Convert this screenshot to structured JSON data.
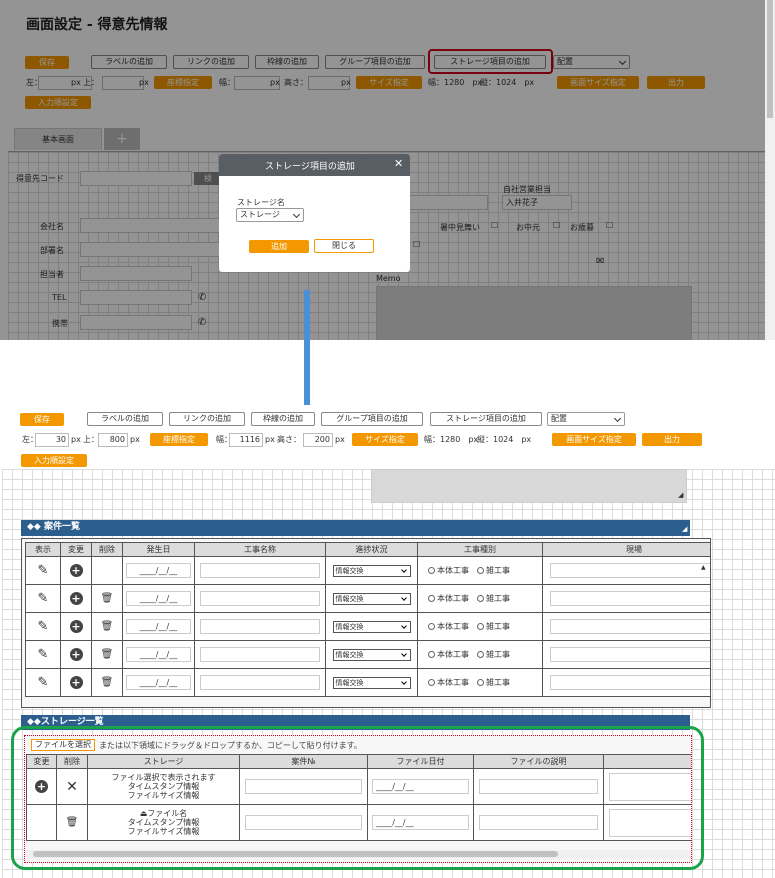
{
  "top": {
    "title": "画面設定 - 得意先情報",
    "toolbar": {
      "save": "保存",
      "add_label": "ラベルの追加",
      "add_link": "リンクの追加",
      "add_frame": "枠線の追加",
      "add_group": "グループ項目の追加",
      "add_storage": "ストレージ項目の追加",
      "layout": "配置"
    },
    "pos": {
      "left_label": "左：",
      "px1": "px",
      "top_label": "上：",
      "px2": "px",
      "coord_btn": "座標指定",
      "width_label": "幅：",
      "px3": "px",
      "height_label": "高さ：",
      "px4": "px",
      "size_btn": "サイズ指定",
      "screen_w": "幅：1280　px",
      "screen_h": "縦：1024　px",
      "screen_size_btn": "画面サイズ指定",
      "output": "出力"
    },
    "input_order": "入力順設定",
    "tab_basic": "基本画面",
    "tab_add": "+",
    "form": {
      "customer_code": "得意先コード",
      "company": "会社名",
      "department": "部署名",
      "person": "担当者",
      "tel": "TEL",
      "mobile": "携帯",
      "sales_rep_label": "自社営業担当",
      "sales_rep_value": "入井花子",
      "summer": "暑中見舞い",
      "ochugen": "お中元",
      "oseibo": "お歳暮",
      "memo": "Memo",
      "code_btn": "検"
    },
    "dialog": {
      "title": "ストレージ項目の追加",
      "field_label": "ストレージ名",
      "select_value": "ストレージ",
      "add": "追加",
      "close": "閉じる"
    }
  },
  "bottom": {
    "toolbar": {
      "save": "保存",
      "add_label": "ラベルの追加",
      "add_link": "リンクの追加",
      "add_frame": "枠線の追加",
      "add_group": "グループ項目の追加",
      "add_storage": "ストレージ項目の追加",
      "layout": "配置"
    },
    "pos": {
      "left_label": "左：",
      "left_value": "30",
      "px1": "px",
      "top_label": "上：",
      "top_value": "800",
      "px2": "px",
      "coord_btn": "座標指定",
      "width_label": "幅：",
      "width_value": "1116",
      "px3": "px",
      "height_label": "高さ：",
      "height_value": "200",
      "px4": "px",
      "size_btn": "サイズ指定",
      "screen_w": "幅：1280　px",
      "screen_h": "縦：1024　px",
      "screen_size_btn": "画面サイズ指定",
      "output": "出力"
    },
    "input_order": "入力順設定",
    "cases": {
      "title": "◆◆ 案件一覧",
      "headers": [
        "表示",
        "変更",
        "削除",
        "発生日",
        "工事名称",
        "進捗状況",
        "工事種別",
        "現場"
      ],
      "rows": [
        {
          "date": "____/__/__",
          "status": "情報交換",
          "opt1": "本体工事",
          "opt2": "雑工事",
          "deletable": false
        },
        {
          "date": "____/__/__",
          "status": "情報交換",
          "opt1": "本体工事",
          "opt2": "雑工事",
          "deletable": true
        },
        {
          "date": "____/__/__",
          "status": "情報交換",
          "opt1": "本体工事",
          "opt2": "雑工事",
          "deletable": true
        },
        {
          "date": "____/__/__",
          "status": "情報交換",
          "opt1": "本体工事",
          "opt2": "雑工事",
          "deletable": true
        },
        {
          "date": "____/__/__",
          "status": "情報交換",
          "opt1": "本体工事",
          "opt2": "雑工事",
          "deletable": true
        }
      ]
    },
    "storage": {
      "title": "◆◆ストレージ一覧",
      "file_select": "ファイルを選択",
      "drop_hint": "または以下領域にドラッグ＆ドロップするか、コピーして貼り付けます。",
      "headers": [
        "変更",
        "削除",
        "ストレージ",
        "案件№",
        "ファイル日付",
        "ファイルの説明"
      ],
      "row1": {
        "line1": "ファイル選択で表示されます",
        "line2": "タイムスタンプ情報",
        "line3": "ファイルサイズ情報",
        "date": "____/__/__"
      },
      "row2": {
        "line1": "ファイル名",
        "line2": "タイムスタンプ情報",
        "line3": "ファイルサイズ情報",
        "date": "____/__/__"
      }
    }
  },
  "colors": {
    "orange": "#f39800",
    "navy": "#2d5f8e",
    "red_highlight": "#d0021b",
    "green_highlight": "#1aa34a",
    "arrow": "#4a90d9"
  }
}
